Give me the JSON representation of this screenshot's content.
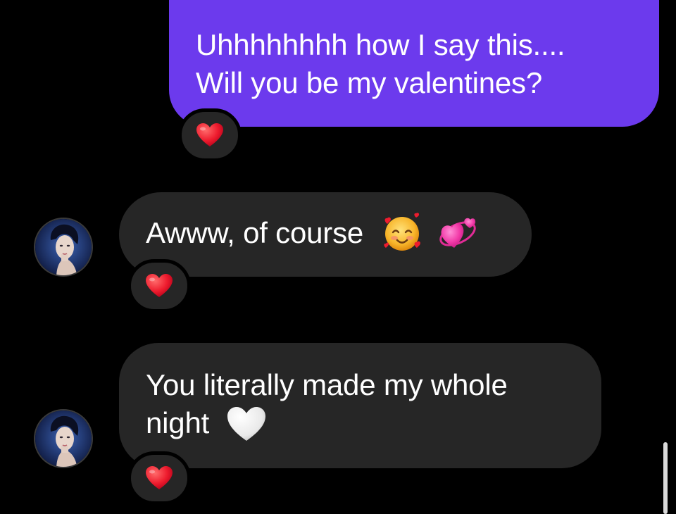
{
  "colors": {
    "background": "#000000",
    "sent_bubble": "#6c3aed",
    "received_bubble": "#262626",
    "text": "#ffffff",
    "heart": "#e0112b"
  },
  "messages": [
    {
      "direction": "sent",
      "lines": [
        "Uhhhhhhhh how I say this....",
        "Will you be my valentines?"
      ],
      "reaction": "red-heart-icon"
    },
    {
      "direction": "received",
      "lines": [
        "Awww, of course"
      ],
      "trailing_emojis": [
        "smiling-face-with-hearts-icon",
        "revolving-hearts-icon"
      ],
      "reaction": "red-heart-icon"
    },
    {
      "direction": "received",
      "lines": [
        "You literally made my whole",
        "night"
      ],
      "trailing_emojis": [
        "white-heart-icon"
      ],
      "reaction": "red-heart-icon"
    }
  ]
}
